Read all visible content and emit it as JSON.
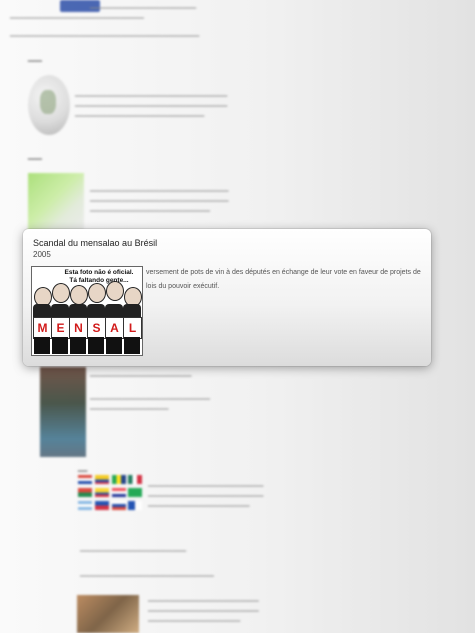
{
  "popup": {
    "title": "Scandal du mensalao au Brésil",
    "year": "2005",
    "text": "versement de pots de vin à des députés en échange de leur vote en faveur de projets de lois du pouvoir exécutif.",
    "image": {
      "caption_line1": "Esta foto não é oficial.",
      "caption_line2": "Tá faltando gente...",
      "letters": [
        "M",
        "E",
        "N",
        "S",
        "A",
        "L"
      ]
    }
  },
  "colors": {
    "popup_bg": "#f2f2f2",
    "sign_letter": "#d21b1b"
  }
}
